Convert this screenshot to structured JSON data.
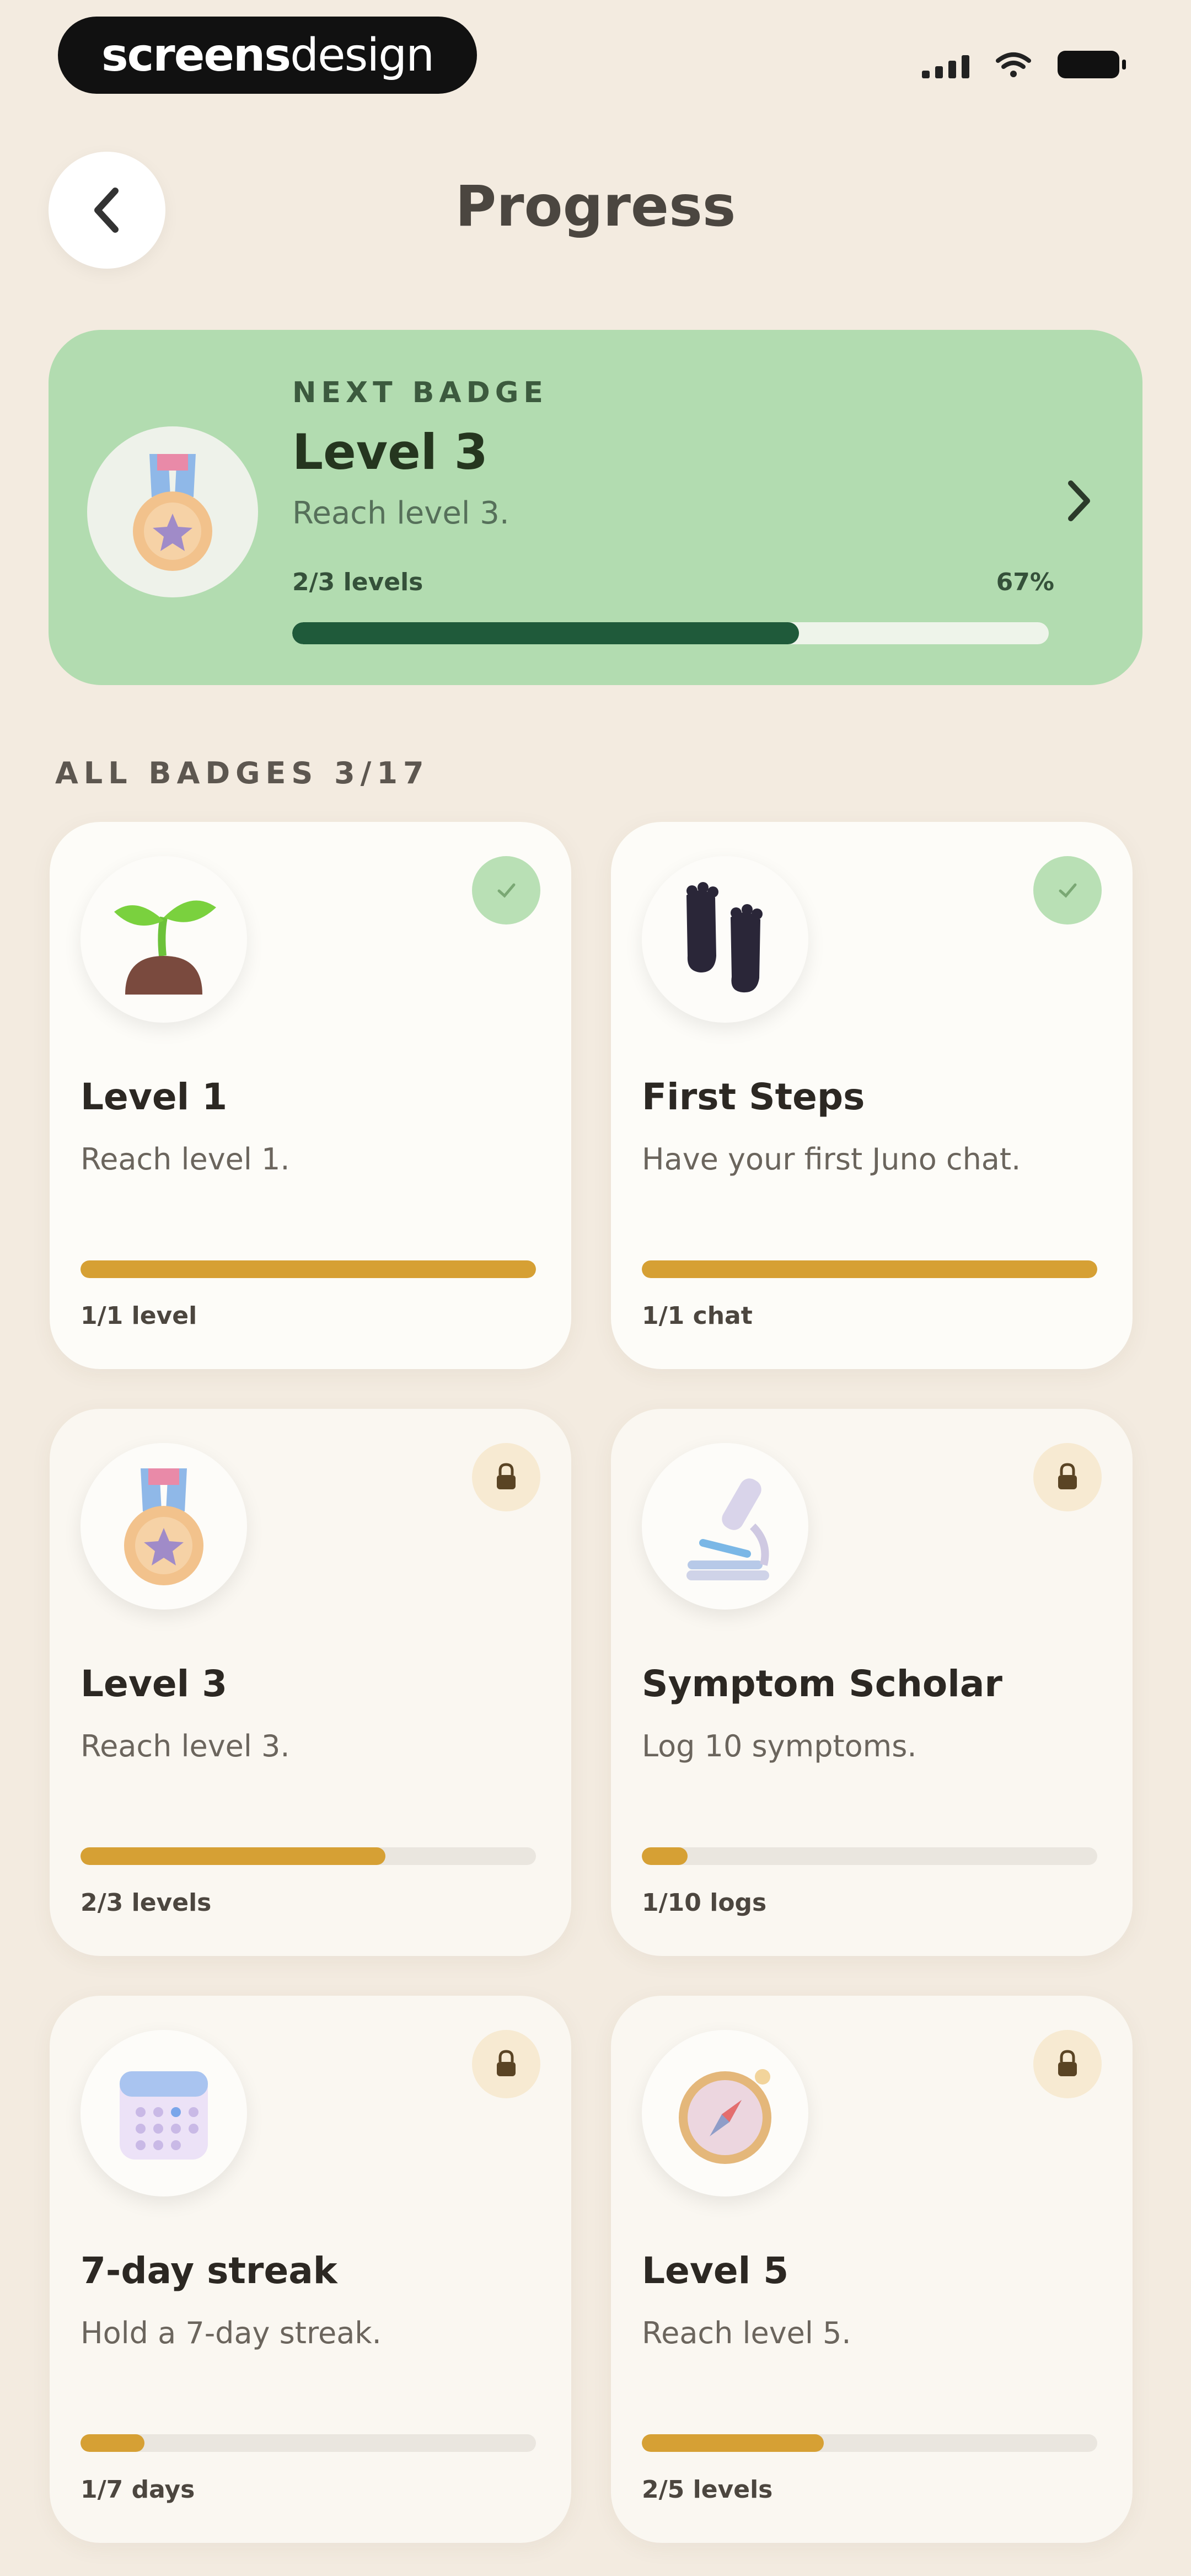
{
  "status_bar": {
    "brand_bold": "screens",
    "brand_light": "design"
  },
  "header": {
    "title": "Progress"
  },
  "next_badge": {
    "kicker": "NEXT BADGE",
    "name": "Level 3",
    "description": "Reach level 3.",
    "count": "2/3 levels",
    "percent_label": "67%",
    "progress": 0.67,
    "icon": "medal-icon",
    "colors": {
      "card": "#b2dcb0",
      "fill": "#1f5a3a"
    }
  },
  "all_badges": {
    "label": "ALL BADGES 3/17",
    "items": [
      {
        "title": "Level 1",
        "desc": "Reach level 1.",
        "count": "1/1 level",
        "progress": 1.0,
        "state": "earned",
        "icon": "seedling-icon"
      },
      {
        "title": "First Steps",
        "desc": "Have your first Juno chat.",
        "count": "1/1 chat",
        "progress": 1.0,
        "state": "earned",
        "icon": "footprints-icon"
      },
      {
        "title": "Level 3",
        "desc": "Reach level 3.",
        "count": "2/3 levels",
        "progress": 0.67,
        "state": "locked",
        "icon": "medal-icon"
      },
      {
        "title": "Symptom Scholar",
        "desc": "Log 10 symptoms.",
        "count": "1/10 logs",
        "progress": 0.1,
        "state": "locked",
        "icon": "microscope-icon"
      },
      {
        "title": "7-day streak",
        "desc": "Hold a 7-day streak.",
        "count": "1/7 days",
        "progress": 0.14,
        "state": "locked",
        "icon": "calendar-icon"
      },
      {
        "title": "Level 5",
        "desc": "Reach level 5.",
        "count": "2/5 levels",
        "progress": 0.4,
        "state": "locked",
        "icon": "compass-icon"
      }
    ]
  },
  "colors": {
    "background": "#f3ebe0",
    "accent_progress": "#d6a034",
    "earned_check": "#b9e0b5",
    "lock_bg": "#f7ead2"
  }
}
